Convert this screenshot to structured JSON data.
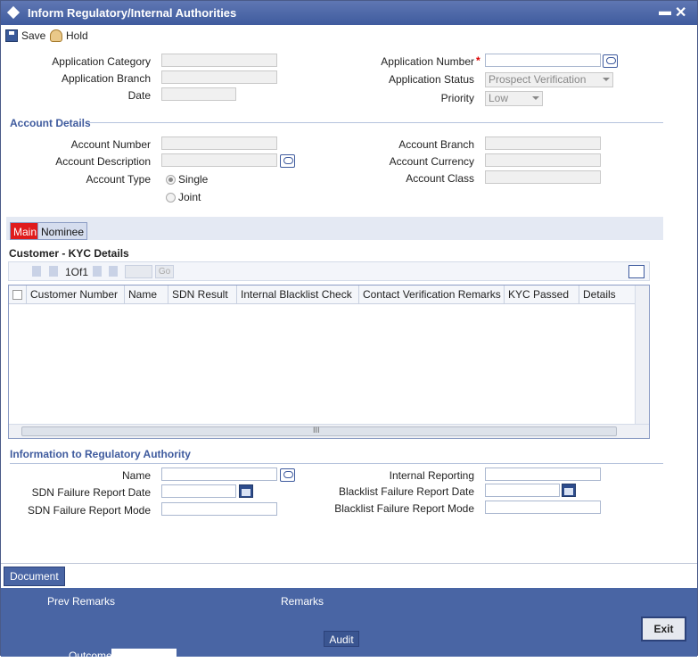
{
  "window": {
    "title": "Inform Regulatory/Internal Authorities"
  },
  "toolbar": {
    "save_label": "Save",
    "hold_label": "Hold"
  },
  "header": {
    "application_category_label": "Application Category",
    "application_branch_label": "Application Branch",
    "date_label": "Date",
    "application_number_label": "Application Number",
    "application_status_label": "Application Status",
    "application_status_value": "Prospect Verification",
    "priority_label": "Priority",
    "priority_value": "Low",
    "required_mark": "*"
  },
  "account_details": {
    "section_title": "Account Details",
    "account_number_label": "Account Number",
    "account_description_label": "Account Description",
    "account_type_label": "Account Type",
    "type_single": "Single",
    "type_joint": "Joint",
    "account_branch_label": "Account Branch",
    "account_currency_label": "Account Currency",
    "account_class_label": "Account Class"
  },
  "tabs": [
    {
      "label": "Main",
      "active": true
    },
    {
      "label": "Nominee",
      "active": false
    }
  ],
  "kyc": {
    "title": "Customer - KYC Details",
    "pager_text": "1Of1",
    "go_label": "Go",
    "columns": [
      "Customer Number",
      "Name",
      "SDN Result",
      "Internal Blacklist Check",
      "Contact Verification Remarks",
      "KYC Passed",
      "Details"
    ],
    "scroll_marker": "III"
  },
  "regulatory": {
    "section_title": "Information to Regulatory Authority",
    "name_label": "Name",
    "sdn_failure_date_label": "SDN Failure Report Date",
    "sdn_failure_mode_label": "SDN Failure Report Mode",
    "internal_reporting_label": "Internal Reporting",
    "blacklist_failure_date_label": "Blacklist Failure Report Date",
    "blacklist_failure_mode_label": "Blacklist Failure Report Mode"
  },
  "footer": {
    "document_label": "Document",
    "prev_remarks_label": "Prev Remarks",
    "remarks_label": "Remarks",
    "audit_label": "Audit",
    "exit_label": "Exit",
    "outcome_label": "Outcome"
  }
}
